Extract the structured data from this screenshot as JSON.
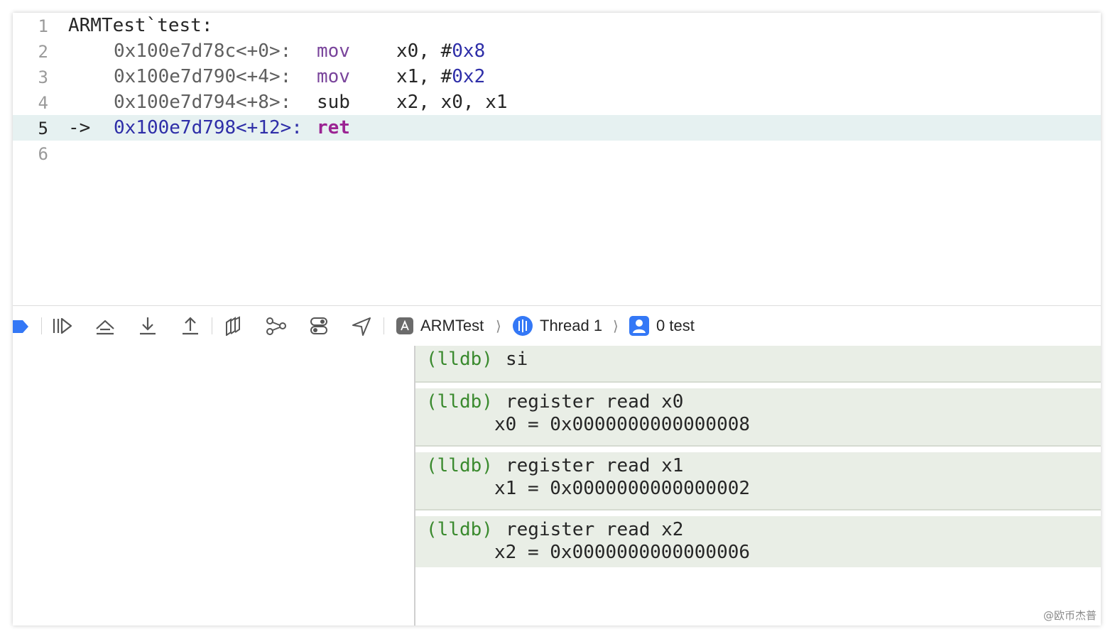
{
  "editor": {
    "lines": [
      {
        "num": "1",
        "text": "ARMTest`test:"
      },
      {
        "num": "2",
        "addr": "0x100e7d78c",
        "offset": "<+0>:",
        "mnemonic": "mov",
        "op1": "x0, #",
        "op2": "0x8"
      },
      {
        "num": "3",
        "addr": "0x100e7d790",
        "offset": "<+4>:",
        "mnemonic": "mov",
        "op1": "x1, #",
        "op2": "0x2"
      },
      {
        "num": "4",
        "addr": "0x100e7d794",
        "offset": "<+8>:",
        "mnemonic": "sub",
        "operands": "x2, x0, x1"
      },
      {
        "num": "5",
        "arrow": "->",
        "addr": "0x100e7d798",
        "offset": "<+12>:",
        "mnemonic": "ret"
      },
      {
        "num": "6"
      }
    ],
    "current_line": 5
  },
  "debugbar": {
    "buttons": [
      "breakpoints-toggle",
      "continue",
      "step-over",
      "step-into",
      "step-out",
      "view-debugger",
      "memory-graph",
      "environment-overrides",
      "simulate-location"
    ],
    "breadcrumb": {
      "app": "ARMTest",
      "thread": "Thread 1",
      "frame": "0 test"
    }
  },
  "console": {
    "entries": [
      {
        "prompt": "(lldb)",
        "command": "si",
        "output": []
      },
      {
        "prompt": "(lldb)",
        "command": "register read x0",
        "output": [
          "x0 = 0x0000000000000008"
        ]
      },
      {
        "prompt": "(lldb)",
        "command": "register read x1",
        "output": [
          "x1 = 0x0000000000000002"
        ]
      },
      {
        "prompt": "(lldb)",
        "command": "register read x2",
        "output": [
          "x2 = 0x0000000000000006"
        ]
      }
    ]
  },
  "watermark": "@欧币杰普",
  "colors": {
    "current_line_bg": "#e6f1f1",
    "prompt": "#3a8a2e",
    "keyword": "#79449b",
    "number": "#2e2ea8",
    "console_bg": "#e9eee6",
    "accent_blue": "#3478f6"
  }
}
